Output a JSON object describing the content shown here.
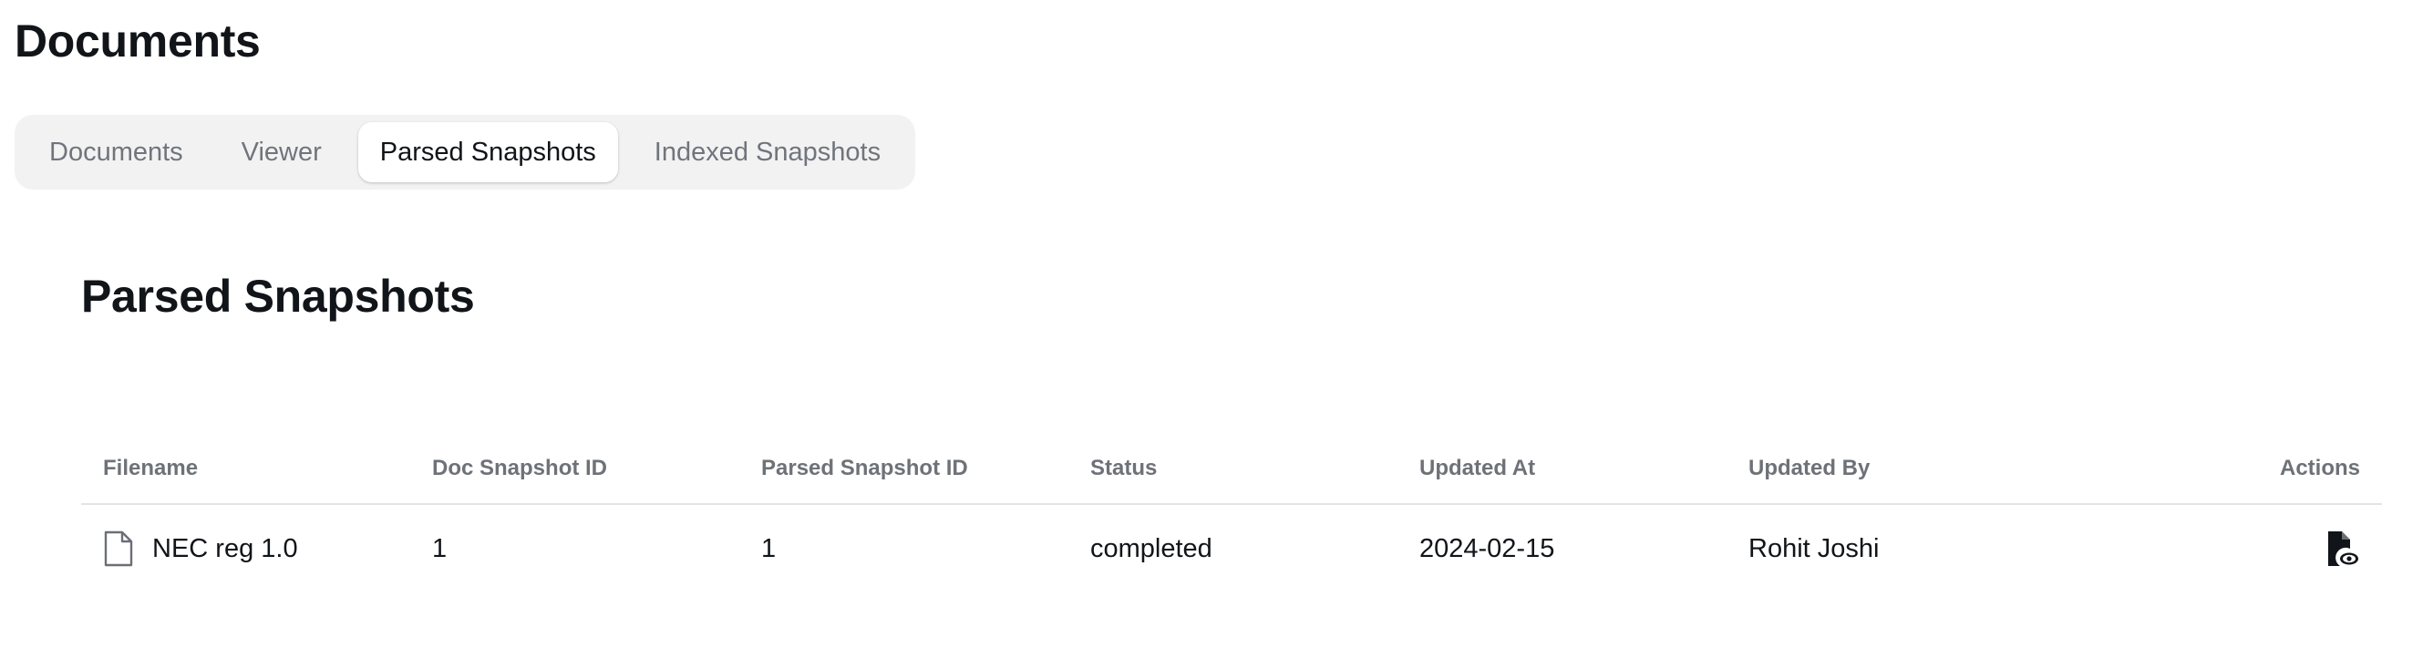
{
  "page": {
    "title": "Documents"
  },
  "tabs": [
    {
      "label": "Documents",
      "active": false
    },
    {
      "label": "Viewer",
      "active": false
    },
    {
      "label": "Parsed Snapshots",
      "active": true
    },
    {
      "label": "Indexed Snapshots",
      "active": false
    }
  ],
  "section": {
    "title": "Parsed Snapshots"
  },
  "table": {
    "columns": {
      "filename": "Filename",
      "doc_snapshot_id": "Doc Snapshot ID",
      "parsed_snapshot_id": "Parsed Snapshot ID",
      "status": "Status",
      "updated_at": "Updated At",
      "updated_by": "Updated By",
      "actions": "Actions"
    },
    "rows": [
      {
        "filename": "NEC reg 1.0",
        "file_icon": "document-icon",
        "doc_snapshot_id": "1",
        "parsed_snapshot_id": "1",
        "status": "completed",
        "updated_at": "2024-02-15",
        "updated_by": "Rohit Joshi",
        "action_icon": "view-document-icon"
      }
    ]
  }
}
